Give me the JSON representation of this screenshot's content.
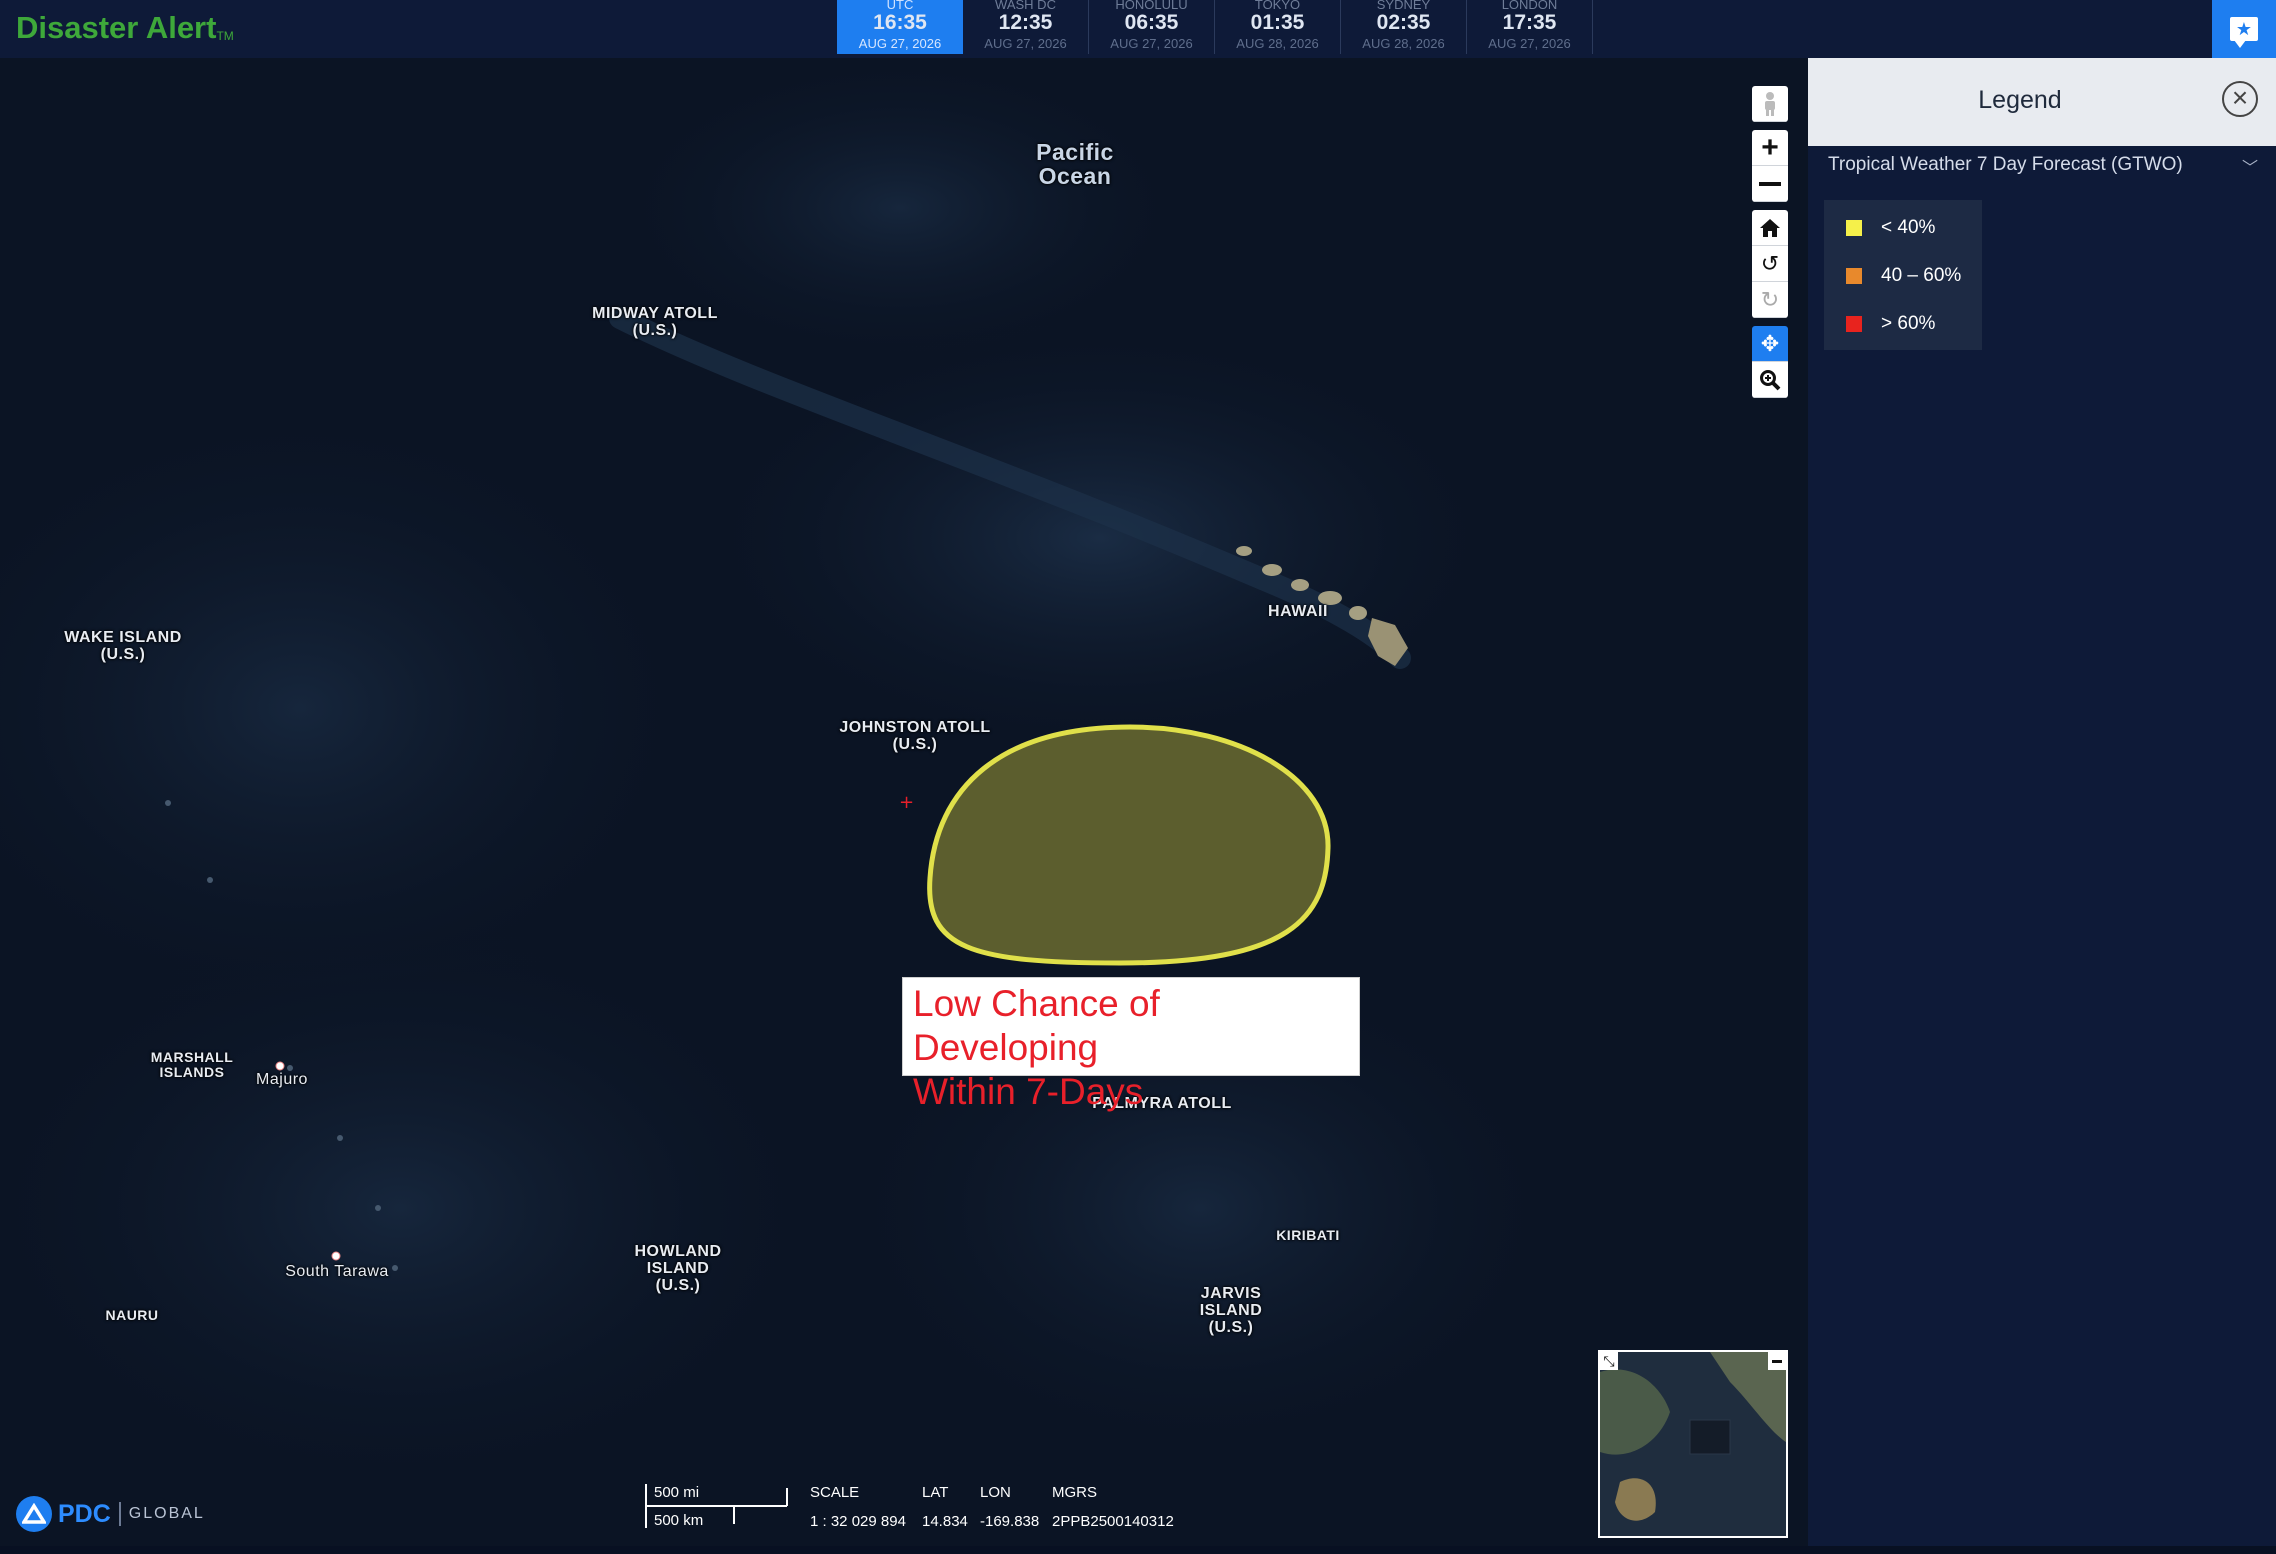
{
  "app": {
    "title": "Disaster Alert",
    "trademark": "TM"
  },
  "clocks": [
    {
      "zone": "UTC",
      "time": "16:35",
      "date": "AUG 27, 2026",
      "active": true
    },
    {
      "zone": "WASH DC",
      "time": "12:35",
      "date": "AUG 27, 2026"
    },
    {
      "zone": "HONOLULU",
      "time": "06:35",
      "date": "AUG 27, 2026"
    },
    {
      "zone": "TOKYO",
      "time": "01:35",
      "date": "AUG 28, 2026"
    },
    {
      "zone": "SYDNEY",
      "time": "02:35",
      "date": "AUG 28, 2026"
    },
    {
      "zone": "LONDON",
      "time": "17:35",
      "date": "AUG 27, 2026"
    }
  ],
  "map": {
    "ocean": {
      "line1": "Pacific",
      "line2": "Ocean"
    },
    "labels": {
      "midway": {
        "line1": "MIDWAY ATOLL",
        "line2": "(U.S.)"
      },
      "wake": {
        "line1": "WAKE ISLAND",
        "line2": "(U.S.)"
      },
      "hawaii": "HAWAII",
      "johnston": {
        "line1": "JOHNSTON ATOLL",
        "line2": "(U.S.)"
      },
      "marshall": {
        "line1": "MARSHALL",
        "line2": "ISLANDS"
      },
      "majuro": "Majuro",
      "palmyra": "PALMYRA ATOLL",
      "kiribati": "KIRIBATI",
      "south_tarawa": "South Tarawa",
      "howland": {
        "line1": "HOWLAND",
        "line2": "ISLAND",
        "line3": "(U.S.)"
      },
      "jarvis": {
        "line1": "JARVIS",
        "line2": "ISLAND",
        "line3": "(U.S.)"
      },
      "nauru": "NAURU"
    },
    "forecast_area": {
      "chance": "< 40%",
      "color": "#e0e04a",
      "fill": "#6b6b30"
    },
    "annotation": {
      "line1": "Low Chance of Developing",
      "line2": "Within 7-Days"
    },
    "scale": {
      "miles": "500 mi",
      "km": "500 km"
    },
    "readout": {
      "scale_label": "SCALE",
      "scale_value": "1 : 32 029 894",
      "lat_label": "LAT",
      "lat_value": "14.834",
      "lon_label": "LON",
      "lon_value": "-169.838",
      "mgrs_label": "MGRS",
      "mgrs_value": "2PPB2500140312"
    }
  },
  "legend": {
    "title": "Legend",
    "layer": "Tropical Weather 7 Day Forecast (GTWO)",
    "items": [
      {
        "label": "< 40%",
        "color": "#f5f04a"
      },
      {
        "label": "40 – 60%",
        "color": "#e8892c"
      },
      {
        "label": "> 60%",
        "color": "#e8231e"
      }
    ]
  },
  "footer": {
    "org": "PDC",
    "region": "GLOBAL"
  },
  "icons": [
    "alert-icon",
    "pegman-icon",
    "zoom-in-icon",
    "zoom-out-icon",
    "home-icon",
    "rotate-left-icon",
    "rotate-right-icon",
    "pan-icon",
    "zoom-box-icon",
    "close-icon",
    "chevron-down-icon"
  ]
}
